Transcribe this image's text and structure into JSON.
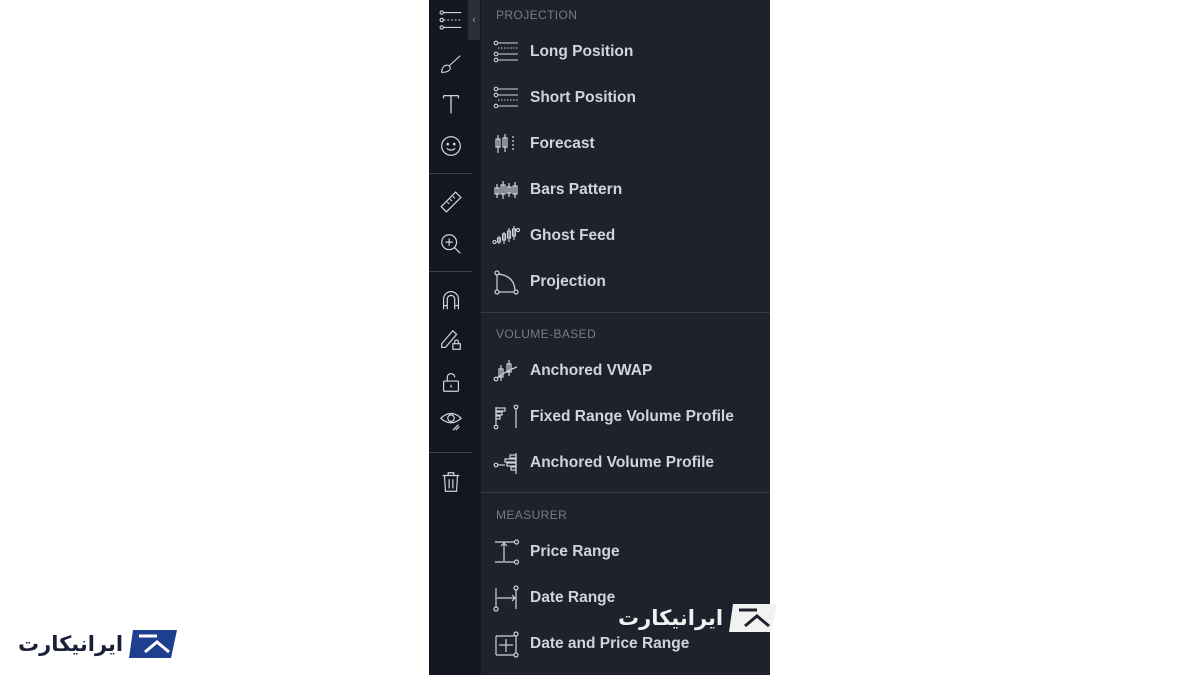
{
  "toolbar": {
    "tools": [
      {
        "name": "trend-line-tools-icon"
      },
      {
        "name": "brush-icon"
      },
      {
        "name": "text-icon"
      },
      {
        "name": "emoji-icon"
      },
      {
        "name": "ruler-icon"
      },
      {
        "name": "zoom-in-icon"
      },
      {
        "name": "magnet-icon"
      },
      {
        "name": "pencil-lock-icon"
      },
      {
        "name": "lock-icon"
      },
      {
        "name": "eye-icon"
      },
      {
        "name": "trash-icon"
      }
    ],
    "collapse_arrow": "‹"
  },
  "menu": {
    "sections": [
      {
        "title": "PROJECTION",
        "items": [
          {
            "label": "Long Position",
            "icon": "long-position-icon"
          },
          {
            "label": "Short Position",
            "icon": "short-position-icon"
          },
          {
            "label": "Forecast",
            "icon": "forecast-icon"
          },
          {
            "label": "Bars Pattern",
            "icon": "bars-pattern-icon"
          },
          {
            "label": "Ghost Feed",
            "icon": "ghost-feed-icon"
          },
          {
            "label": "Projection",
            "icon": "projection-icon"
          }
        ]
      },
      {
        "title": "VOLUME-BASED",
        "items": [
          {
            "label": "Anchored VWAP",
            "icon": "anchored-vwap-icon"
          },
          {
            "label": "Fixed Range Volume Profile",
            "icon": "fixed-range-volume-profile-icon"
          },
          {
            "label": "Anchored Volume Profile",
            "icon": "anchored-volume-profile-icon"
          }
        ]
      },
      {
        "title": "MEASURER",
        "items": [
          {
            "label": "Price Range",
            "icon": "price-range-icon"
          },
          {
            "label": "Date Range",
            "icon": "date-range-icon"
          },
          {
            "label": "Date and Price Range",
            "icon": "date-and-price-range-icon"
          }
        ]
      }
    ]
  },
  "watermark": {
    "text": "ایرانیکارت"
  },
  "colors": {
    "toolbar_bg": "#131722",
    "menu_bg": "#1e222d",
    "text": "#d1d4dc",
    "section_title": "#787b86",
    "watermark_brand": "#1e3f8f"
  }
}
